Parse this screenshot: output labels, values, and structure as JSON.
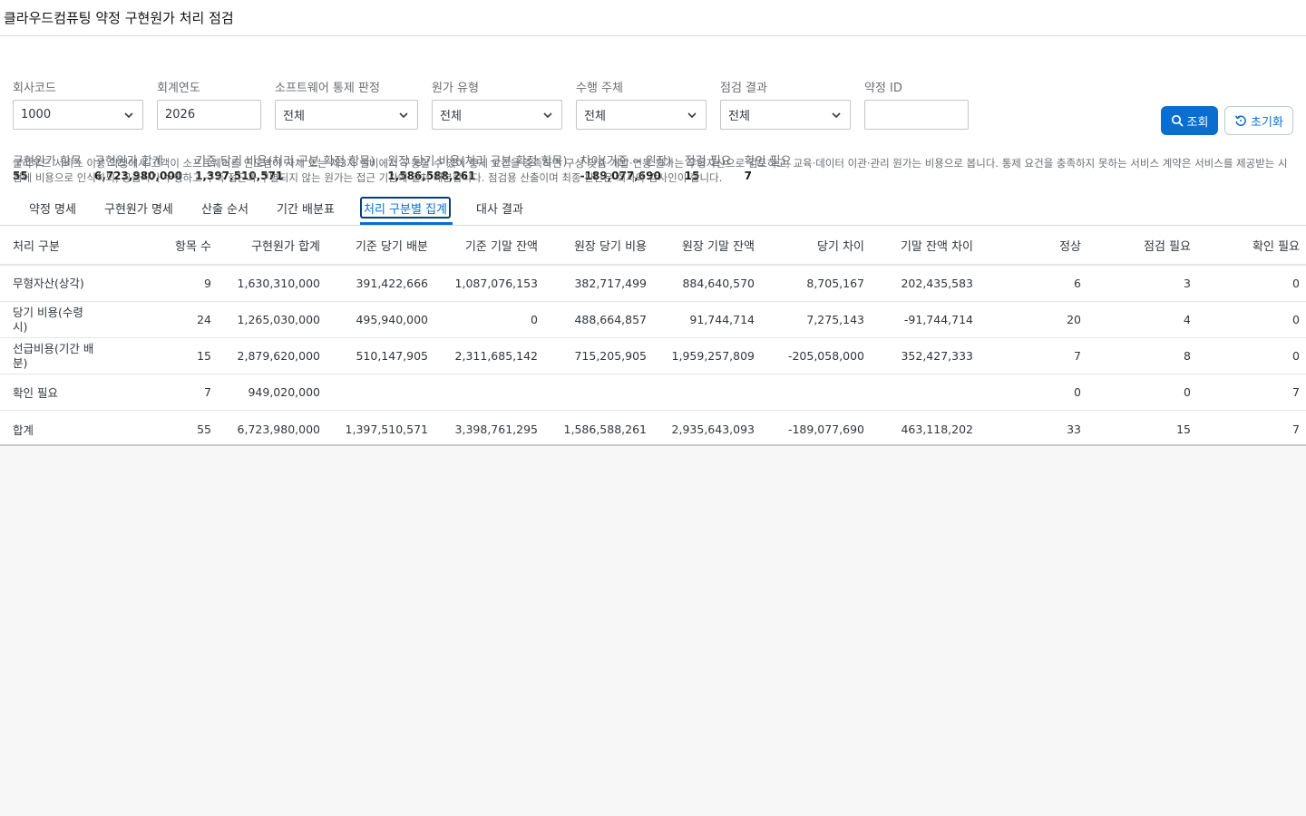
{
  "app": {
    "title": "클라우드컴퓨팅 약정 구현원가 처리 점검"
  },
  "filters": [
    {
      "label": "회사코드",
      "value": "1000",
      "type": "select"
    },
    {
      "label": "회계연도",
      "value": "2026",
      "type": "input"
    },
    {
      "label": "소프트웨어 통제 판정",
      "value": "전체",
      "type": "select"
    },
    {
      "label": "원가 유형",
      "value": "전체",
      "type": "select"
    },
    {
      "label": "수행 주체",
      "value": "전체",
      "type": "select"
    },
    {
      "label": "점검 결과",
      "value": "전체",
      "type": "select"
    },
    {
      "label": "약정 ID",
      "value": "",
      "type": "input"
    }
  ],
  "actions": {
    "search_label": "조회",
    "reset_label": "초기화"
  },
  "kpis": [
    {
      "label": "구현원가 항목",
      "value": "55"
    },
    {
      "label": "구현원가 합계",
      "value": "6,723,980,000"
    },
    {
      "label": "기준 당기 비용(처리 구분 확정 항목)",
      "value": "1,397,510,571"
    },
    {
      "label": "원장 당기 비용(처리 구분 확정 항목)",
      "value": "1,586,588,261"
    },
    {
      "label": "차이(기준 − 원장)",
      "value": "-189,077,690"
    },
    {
      "label": "점검 필요",
      "value": "15"
    },
    {
      "label": "확인 필요",
      "value": "7"
    }
  ],
  "description": "클라우드 서비스 이용 약정에서 고객이 소프트웨어를 인도받아 자체 또는 제3자 설비에서 구동할 수 있어 통제 요건을 충족하면 구성·맞춤 개발·연동 원가는 무형자산으로 검토하고, 교육·데이터 이관·관리 원가는 비용으로 봅니다. 통제 요건을 충족하지 못하는 서비스 계약은 서비스를 제공받는 시점에 비용으로 인식하되, 공급사가 수행하고 구독 접근과 구별되지 않는 원가는 접근 기간에 걸쳐 배분합니다. 점검용 산출이며 최종 판단은 회사와 감사인이 합니다.",
  "tabs": [
    {
      "label": "약정 명세",
      "active": false
    },
    {
      "label": "구현원가 명세",
      "active": false
    },
    {
      "label": "산출 순서",
      "active": false
    },
    {
      "label": "기간 배분표",
      "active": false
    },
    {
      "label": "처리 구분별 집계",
      "active": true
    },
    {
      "label": "대사 결과",
      "active": false
    }
  ],
  "table": {
    "headers": [
      "처리 구분",
      "항목 수",
      "구현원가 합계",
      "기준 당기 배분",
      "기준 기말 잔액",
      "원장 당기 비용",
      "원장 기말 잔액",
      "당기 차이",
      "기말 잔액 차이",
      "정상",
      "점검 필요",
      "확인 필요"
    ],
    "rows": [
      [
        "무형자산(상각)",
        "9",
        "1,630,310,000",
        "391,422,666",
        "1,087,076,153",
        "382,717,499",
        "884,640,570",
        "8,705,167",
        "202,435,583",
        "6",
        "3",
        "0"
      ],
      [
        "당기 비용(수령 시)",
        "24",
        "1,265,030,000",
        "495,940,000",
        "0",
        "488,664,857",
        "91,744,714",
        "7,275,143",
        "-91,744,714",
        "20",
        "4",
        "0"
      ],
      [
        "선급비용(기간 배분)",
        "15",
        "2,879,620,000",
        "510,147,905",
        "2,311,685,142",
        "715,205,905",
        "1,959,257,809",
        "-205,058,000",
        "352,427,333",
        "7",
        "8",
        "0"
      ],
      [
        "확인 필요",
        "7",
        "949,020,000",
        "",
        "",
        "",
        "",
        "",
        "",
        "0",
        "0",
        "7"
      ],
      [
        "합계",
        "55",
        "6,723,980,000",
        "1,397,510,571",
        "3,398,761,295",
        "1,586,588,261",
        "2,935,643,093",
        "-189,077,690",
        "463,118,202",
        "33",
        "15",
        "7"
      ]
    ]
  },
  "colors": {
    "accent": "#0a6ed1",
    "active_tab_outline": "#0a3d7a",
    "background": "#f7f7f7"
  }
}
